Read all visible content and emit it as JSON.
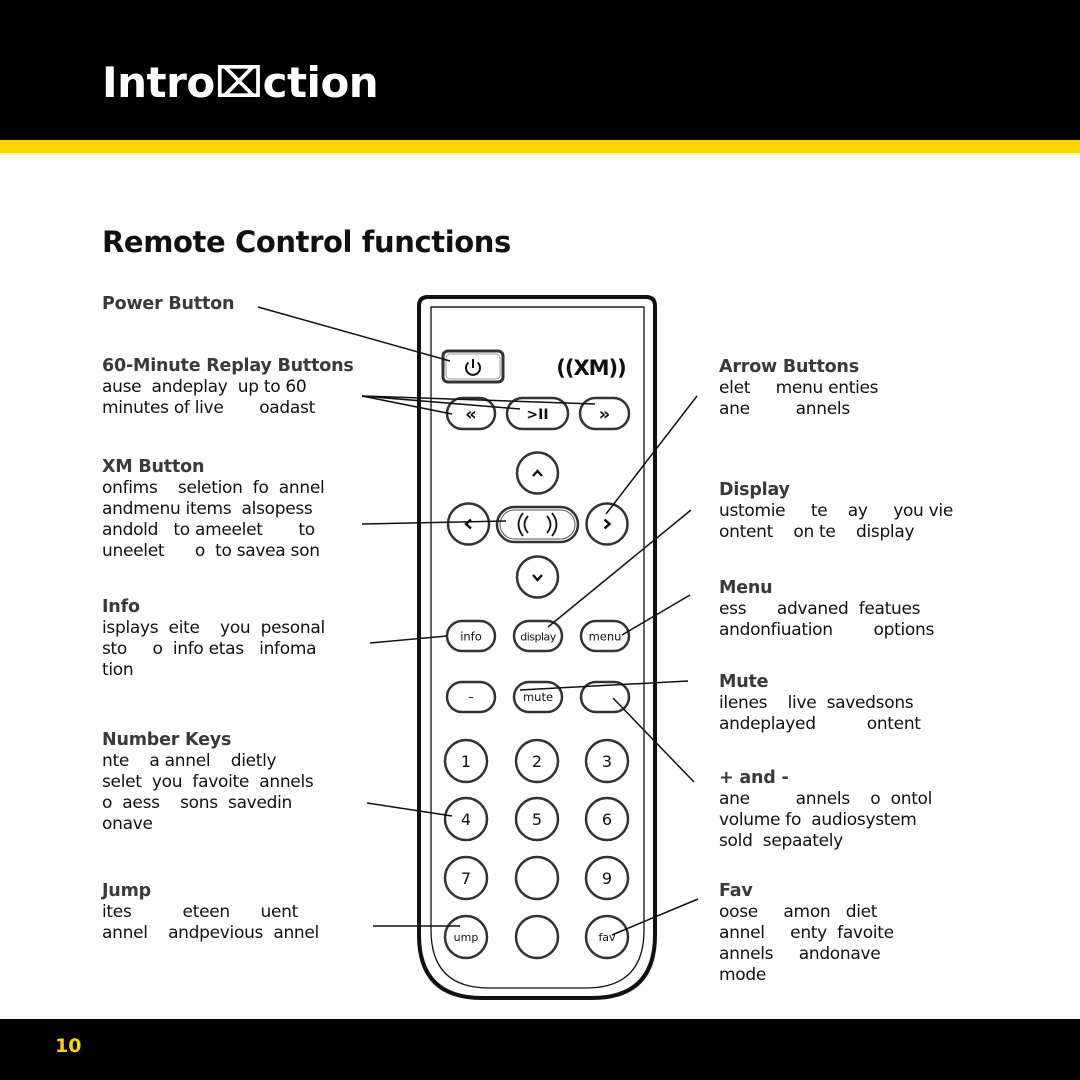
{
  "header": {
    "title": "Intro⌧ction",
    "accent_color": "#ffd400"
  },
  "page_title": "Remote Control functions",
  "left_callouts": [
    {
      "heading": "Power Button",
      "body": ""
    },
    {
      "heading": "60-Minute Replay Buttons",
      "body": "ause  andeplay  up to 60\nminutes of live       oadast"
    },
    {
      "heading": "XM Button",
      "body": "onfims    seletion  fo  annel\nandmenu items  alsopess\nandold   to ameelet       to\nuneelet      o  to savea son"
    },
    {
      "heading": "Info",
      "body": "isplays  eite    you  pesonal\nsto     o  info etas   infoma\ntion"
    },
    {
      "heading": "Number Keys",
      "body": "nte    a annel    dietly\nselet  you  favoite  annels\no  aess    sons  savedin\nonave"
    },
    {
      "heading": "Jump",
      "body": "ites          eteen      uent\nannel    andpevious  annel"
    }
  ],
  "right_callouts": [
    {
      "heading": "Arrow Buttons",
      "body": "elet     menu enties\nane         annels"
    },
    {
      "heading": "Display",
      "body": "ustomie     te    ay     you vie\nontent    on te    display"
    },
    {
      "heading": "Menu",
      "body": "ess      advaned  featues\nandonfiuation        options"
    },
    {
      "heading": "Mute",
      "body": "ilenes    live  savedsons\nandeplayed          ontent"
    },
    {
      "heading": "+ and -",
      "body": "ane         annels    o  ontol\nvolume fo  audiosystem\nsold  sepaately"
    },
    {
      "heading": "Fav",
      "body": "oose     amon   diet\nannel     enty  favoite\nannels     andonave\nmode"
    }
  ],
  "remote": {
    "power_icon": "power-icon",
    "logo": "((XM))",
    "replay_buttons": [
      "«",
      ">II",
      "»"
    ],
    "xm_button_label": "(( ))",
    "arrow_up": "˄",
    "arrow_down": "˅",
    "arrow_left": "<",
    "arrow_right": ">",
    "function_buttons": [
      "info",
      "display",
      "menu"
    ],
    "volume_minus": "–",
    "mute": "mute",
    "volume_plus": "",
    "number_keys": [
      "1",
      "2",
      "3",
      "4",
      "5",
      "6",
      "7",
      "",
      "9"
    ],
    "jump": "ump",
    "zero": "",
    "fav": "fav"
  },
  "footer": {
    "page_number": "10"
  }
}
